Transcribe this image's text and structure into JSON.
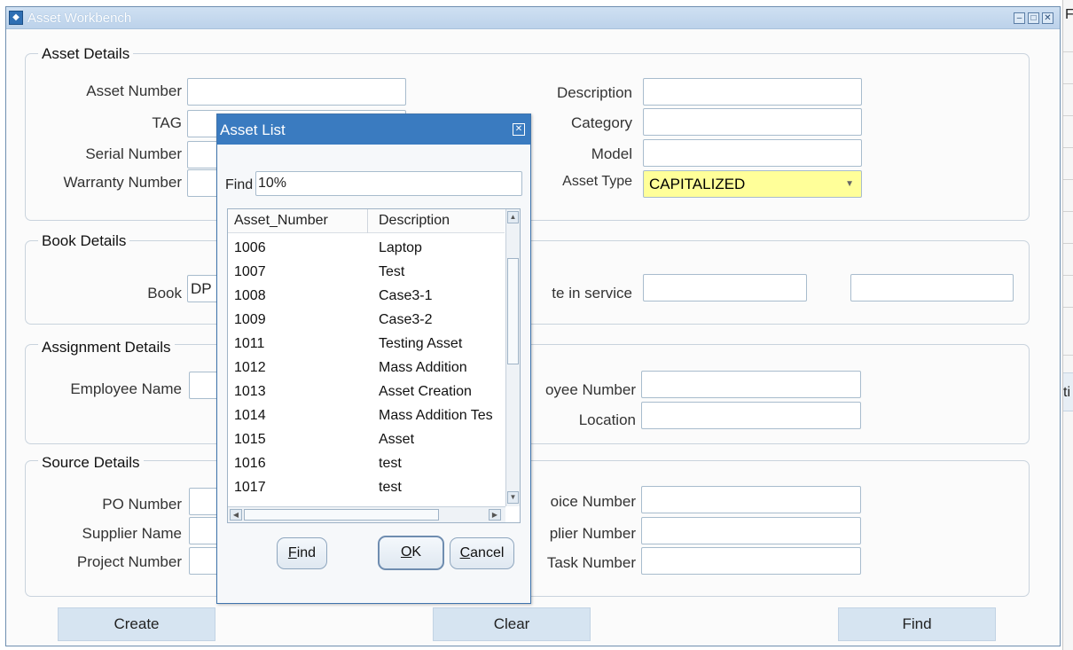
{
  "window": {
    "title": "Asset Workbench",
    "min": "‒",
    "max": "□",
    "close": "✕"
  },
  "right_strip": {
    "top_glyph": "F",
    "mid_text": "ti"
  },
  "asset_details": {
    "title": "Asset Details",
    "asset_number_label": "Asset Number",
    "tag_label": "TAG",
    "serial_label": "Serial Number",
    "warranty_label": "Warranty Number",
    "description_label": "Description",
    "category_label": "Category",
    "model_label": "Model",
    "asset_type_label": "Asset Type",
    "asset_type_value": "CAPITALIZED"
  },
  "book_details": {
    "title": "Book Details",
    "book_label": "Book",
    "book_value": "DP",
    "date_in_service_label": "te in service"
  },
  "assignment_details": {
    "title": "Assignment Details",
    "employee_name_label": "Employee Name",
    "employee_number_label": "oyee Number",
    "location_label": "Location"
  },
  "source_details": {
    "title": "Source Details",
    "po_label": "PO Number",
    "supplier_name_label": "Supplier Name",
    "project_label": "Project Number",
    "invoice_label": "oice Number",
    "supplier_number_label": "plier Number",
    "task_label": "Task Number"
  },
  "footer": {
    "create": "Create",
    "clear": "Clear",
    "find": "Find"
  },
  "dialog": {
    "title": "Asset List",
    "close": "✕",
    "find_label": "Find",
    "find_value": "10%",
    "columns": [
      "Asset_Number",
      "Description"
    ],
    "rows": [
      [
        "1006",
        "Laptop"
      ],
      [
        "1007",
        "Test"
      ],
      [
        "1008",
        "Case3-1"
      ],
      [
        "1009",
        "Case3-2"
      ],
      [
        "1011",
        "Testing Asset"
      ],
      [
        "1012",
        "Mass Addition"
      ],
      [
        "1013",
        "Asset Creation"
      ],
      [
        "1014",
        "Mass Addition Tes"
      ],
      [
        "1015",
        "Asset"
      ],
      [
        "1016",
        "test"
      ],
      [
        "1017",
        "test"
      ]
    ],
    "buttons": {
      "find_u": "F",
      "find_rest": "ind",
      "ok_u": "O",
      "ok_rest": "K",
      "cancel_u": "C",
      "cancel_rest": "ancel"
    }
  }
}
